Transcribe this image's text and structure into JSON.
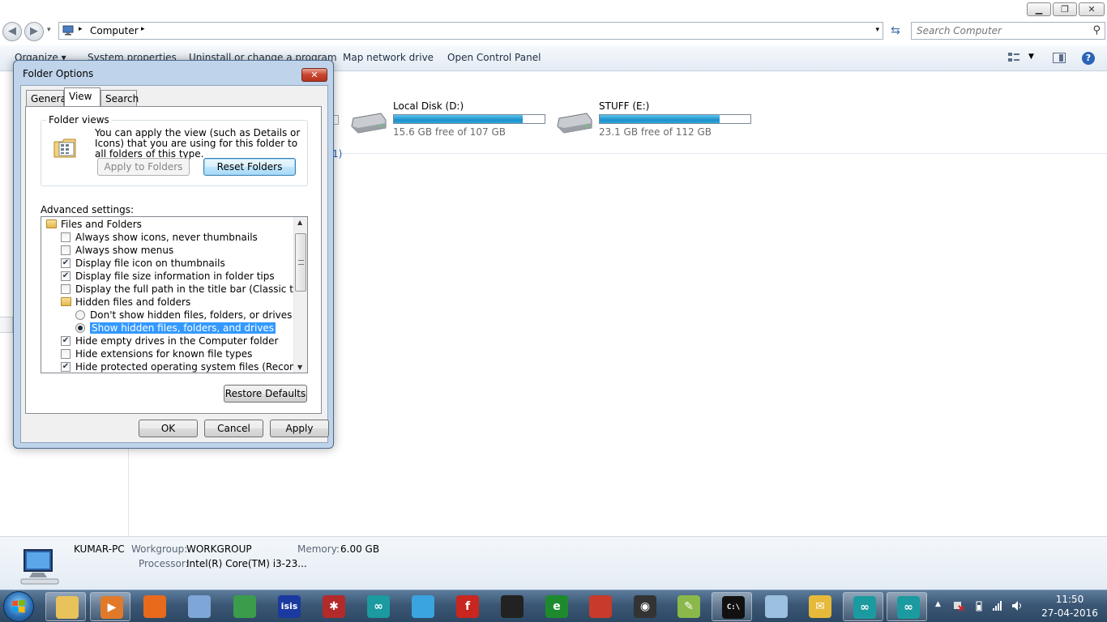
{
  "explorer": {
    "window_buttons": {
      "minimize": "▁",
      "maximize": "❐",
      "close": "✕"
    },
    "nav": {
      "back": "◀",
      "forward": "▶",
      "recent": "▾"
    },
    "address": {
      "crumb": "Computer",
      "sep": "▸",
      "dropdown": "▾"
    },
    "refresh": "⇆",
    "search": {
      "placeholder": "Search Computer",
      "icon": "magnifier-icon"
    },
    "commands": [
      "Organize ▾",
      "System properties",
      "Uninstall or change a program",
      "Map network drive",
      "Open Control Panel"
    ],
    "partial_text": "1)",
    "drives": [
      {
        "name": "Local Disk (D:)",
        "free_text": "15.6 GB free of 107 GB",
        "used_fraction": 0.854
      },
      {
        "name": "STUFF (E:)",
        "free_text": "23.1 GB free of 112 GB",
        "used_fraction": 0.794
      }
    ],
    "details": {
      "pc_name": "KUMAR-PC",
      "workgroup_label": "Workgroup:",
      "workgroup_value": "WORKGROUP",
      "memory_label": "Memory:",
      "memory_value": "6.00 GB",
      "processor_label": "Processor:",
      "processor_value": "Intel(R) Core(TM) i3-23..."
    }
  },
  "dialog": {
    "title": "Folder Options",
    "close": "✕",
    "tabs": [
      "General",
      "View",
      "Search"
    ],
    "selected_tab": "View",
    "folder_views": {
      "legend": "Folder views",
      "text": "You can apply the view (such as Details or Icons) that you are using for this folder to all folders of this type.",
      "apply_button": "Apply to Folders",
      "reset_button": "Reset Folders"
    },
    "advanced_label": "Advanced settings:",
    "advanced_items": [
      {
        "type": "folder",
        "label": "Files and Folders",
        "indent": 0
      },
      {
        "type": "checkbox",
        "label": "Always show icons, never thumbnails",
        "checked": false,
        "indent": 1
      },
      {
        "type": "checkbox",
        "label": "Always show menus",
        "checked": false,
        "indent": 1
      },
      {
        "type": "checkbox",
        "label": "Display file icon on thumbnails",
        "checked": true,
        "indent": 1
      },
      {
        "type": "checkbox",
        "label": "Display file size information in folder tips",
        "checked": true,
        "indent": 1
      },
      {
        "type": "checkbox",
        "label": "Display the full path in the title bar (Classic theme only)",
        "checked": false,
        "indent": 1
      },
      {
        "type": "folder",
        "label": "Hidden files and folders",
        "indent": 1
      },
      {
        "type": "radio",
        "label": "Don't show hidden files, folders, or drives",
        "checked": false,
        "indent": 2
      },
      {
        "type": "radio",
        "label": "Show hidden files, folders, and drives",
        "checked": true,
        "selected": true,
        "indent": 2
      },
      {
        "type": "checkbox",
        "label": "Hide empty drives in the Computer folder",
        "checked": true,
        "indent": 1
      },
      {
        "type": "checkbox",
        "label": "Hide extensions for known file types",
        "checked": false,
        "indent": 1
      },
      {
        "type": "checkbox",
        "label": "Hide protected operating system files (Recommended)",
        "checked": true,
        "indent": 1
      }
    ],
    "restore_button": "Restore Defaults",
    "ok_button": "OK",
    "cancel_button": "Cancel",
    "apply_button": "Apply",
    "scroll": {
      "up": "▲",
      "down": "▼"
    }
  },
  "taskbar": {
    "apps": [
      {
        "name": "explorer-icon",
        "glyph": "",
        "color": "#e8c25a",
        "active": true
      },
      {
        "name": "media-player-icon",
        "glyph": "▶",
        "color": "#e07a2a",
        "active": true
      },
      {
        "name": "firefox-icon",
        "glyph": "",
        "color": "#e86a1c"
      },
      {
        "name": "window-icon",
        "glyph": "",
        "color": "#7ea6d6"
      },
      {
        "name": "chrome-icon",
        "glyph": "",
        "color": "#3b9d4b"
      },
      {
        "name": "isis-icon",
        "glyph": "isis",
        "color": "#1a3aa0"
      },
      {
        "name": "ladybug-icon",
        "glyph": "✱",
        "color": "#b22a2a"
      },
      {
        "name": "arduino-icon",
        "glyph": "∞",
        "color": "#1b9aa0"
      },
      {
        "name": "network-icon",
        "glyph": "",
        "color": "#3aa4e0"
      },
      {
        "name": "fritzing-icon",
        "glyph": "f",
        "color": "#c8261e"
      },
      {
        "name": "chip-icon",
        "glyph": "",
        "color": "#222222"
      },
      {
        "name": "eagle-icon",
        "glyph": "e",
        "color": "#1e8a2e"
      },
      {
        "name": "bird-icon",
        "glyph": "",
        "color": "#c83a2a"
      },
      {
        "name": "circuit-icon",
        "glyph": "◉",
        "color": "#333333"
      },
      {
        "name": "notepadpp-icon",
        "glyph": "✎",
        "color": "#8ab84a"
      },
      {
        "name": "cmd-icon",
        "glyph": "C:\\",
        "color": "#111111",
        "active": true
      },
      {
        "name": "notes-icon",
        "glyph": "",
        "color": "#9cc0e0"
      },
      {
        "name": "outlook-icon",
        "glyph": "✉",
        "color": "#e6b93a"
      },
      {
        "name": "arduino2-icon",
        "glyph": "∞",
        "color": "#1b9aa0",
        "active": true
      },
      {
        "name": "arduino3-icon",
        "glyph": "∞",
        "color": "#1b9aa0",
        "active": true
      }
    ],
    "tray": {
      "show_hidden": "▲"
    },
    "clock": {
      "time": "11:50",
      "date": "27-04-2016"
    }
  }
}
